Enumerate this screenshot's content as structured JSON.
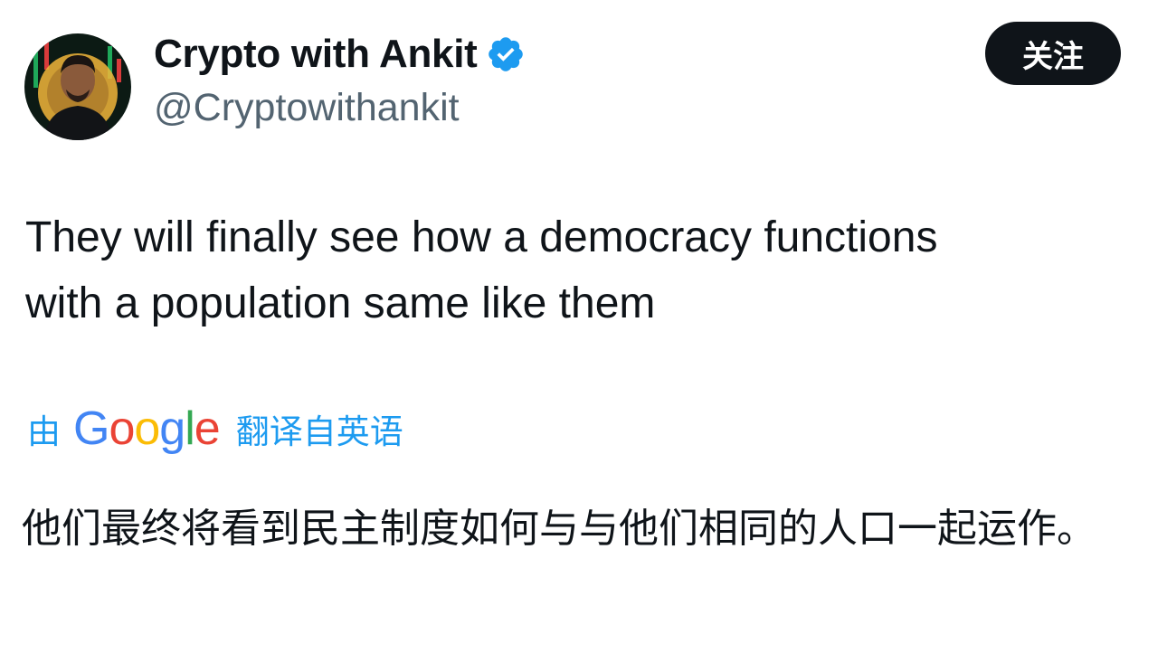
{
  "tweet": {
    "author": {
      "display_name": "Crypto with Ankit",
      "handle": "@Cryptowithankit",
      "verified": true
    },
    "follow_label": "关注",
    "text": "They will finally see how a democracy functions\nwith a population same like them",
    "translation": {
      "prefix": "由",
      "provider": "Google",
      "suffix": "翻译自英语",
      "text": "他们最终将看到民主制度如何与与他们相同的人口一起运作。"
    }
  },
  "colors": {
    "text_primary": "#0f1419",
    "text_secondary": "#536471",
    "link_blue": "#1d9bf0",
    "verified_blue": "#1d9bf0",
    "button_bg": "#0f1419"
  }
}
